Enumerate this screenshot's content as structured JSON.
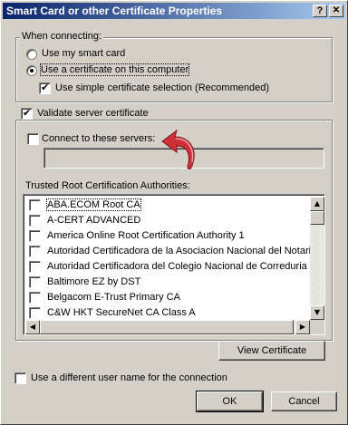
{
  "window": {
    "title": "Smart Card or other Certificate Properties",
    "help_glyph": "?",
    "close_glyph": "✕"
  },
  "connecting": {
    "legend": "When connecting:",
    "option_smart_card": "Use my smart card",
    "option_certificate": "Use a certificate on this computer",
    "selected_option": "certificate",
    "simple_selection_label": "Use simple certificate selection (Recommended)",
    "simple_selection_checked": true
  },
  "validate": {
    "label": "Validate server certificate",
    "checked": true,
    "connect_servers_label": "Connect to these servers:",
    "connect_servers_checked": false,
    "servers_value": ""
  },
  "trusted_root": {
    "label": "Trusted Root Certification Authorities:",
    "items": [
      {
        "name": "ABA.ECOM Root CA",
        "checked": false
      },
      {
        "name": "A-CERT ADVANCED",
        "checked": false
      },
      {
        "name": "America Online Root Certification Authority 1",
        "checked": false
      },
      {
        "name": "Autoridad Certificadora de la Asociacion Nacional del Notariado",
        "checked": false
      },
      {
        "name": "Autoridad Certificadora del Colegio Nacional de Correduria Publica",
        "checked": false
      },
      {
        "name": "Baltimore EZ by DST",
        "checked": false
      },
      {
        "name": "Belgacom E-Trust Primary CA",
        "checked": false
      },
      {
        "name": "C&W HKT SecureNet CA Class A",
        "checked": false
      }
    ],
    "scroll_up_glyph": "▲",
    "scroll_down_glyph": "▼",
    "scroll_left_glyph": "◀",
    "scroll_right_glyph": "▶"
  },
  "view_certificate_button": "View Certificate",
  "different_user": {
    "label": "Use a different user name for the connection",
    "checked": false
  },
  "buttons": {
    "ok": "OK",
    "cancel": "Cancel"
  },
  "colors": {
    "title_start": "#0a246a",
    "title_end": "#a6caf0",
    "face": "#d4d0c8",
    "annotation_arrow": "#d0303a"
  }
}
